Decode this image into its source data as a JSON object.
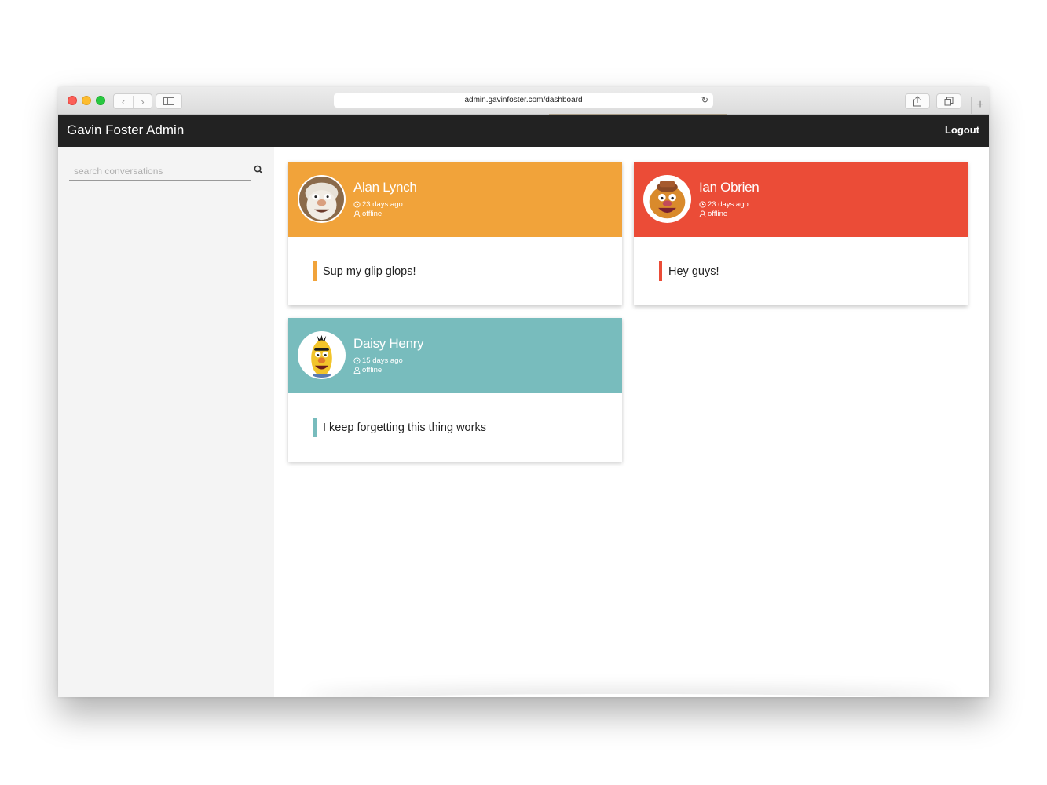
{
  "browser": {
    "url": "admin.gavinfoster.com/dashboard",
    "new_tab_label": "+",
    "back_glyph": "‹",
    "forward_glyph": "›",
    "reload_glyph": "↻"
  },
  "header": {
    "title": "Gavin Foster Admin",
    "logout_label": "Logout"
  },
  "sidebar": {
    "search": {
      "placeholder": "search conversations",
      "value": "",
      "icon": "search-icon"
    }
  },
  "conversations": [
    {
      "name": "Alan Lynch",
      "time": "23 days ago",
      "status": "offline",
      "message": "Sup my glip glops!",
      "color": "#f1a33a",
      "avatar": "muppet-white-beard"
    },
    {
      "name": "Ian Obrien",
      "time": "23 days ago",
      "status": "offline",
      "message": "Hey guys!",
      "color": "#eb4c37",
      "avatar": "muppet-bear"
    },
    {
      "name": "Daisy Henry",
      "time": "15 days ago",
      "status": "offline",
      "message": "I keep forgetting this thing works",
      "color": "#78bcbd",
      "avatar": "muppet-yellow-unibrow"
    }
  ]
}
